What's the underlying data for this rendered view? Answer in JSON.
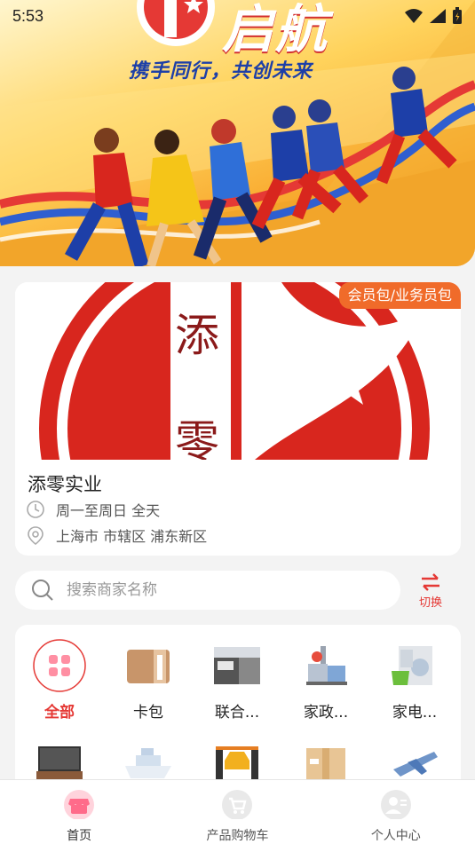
{
  "status_bar": {
    "time": "5:53"
  },
  "banner": {
    "title": "启航",
    "slogan": "携手同行，共创未来"
  },
  "store": {
    "badge": "会员包/业务员包",
    "logo_text_top": "添",
    "logo_text_bottom": "零",
    "name": "添零实业",
    "hours": "周一至周日 全天",
    "address": "上海市 市辖区 浦东新区"
  },
  "search": {
    "placeholder": "搜索商家名称",
    "value": ""
  },
  "switch": {
    "label": "切换"
  },
  "categories": [
    {
      "label": "全部",
      "icon": "grid-icon",
      "active": true
    },
    {
      "label": "卡包",
      "icon": "wallet-icon"
    },
    {
      "label": "联合...",
      "icon": "kitchen-icon"
    },
    {
      "label": "家政...",
      "icon": "housekeeping-icon"
    },
    {
      "label": "家电...",
      "icon": "appliance-icon"
    }
  ],
  "categories_row2": [
    {
      "icon": "tv-icon"
    },
    {
      "icon": "ship-icon"
    },
    {
      "icon": "car-icon"
    },
    {
      "icon": "package-icon"
    },
    {
      "icon": "aircraft-icon"
    }
  ],
  "bottom_nav": [
    {
      "label": "首页",
      "icon": "shop-icon",
      "active": true
    },
    {
      "label": "产品购物车",
      "icon": "cart-icon"
    },
    {
      "label": "个人中心",
      "icon": "user-icon"
    }
  ],
  "colors": {
    "accent": "#e53935",
    "badge": "#f06b2a",
    "slogan": "#1d3fa8"
  }
}
